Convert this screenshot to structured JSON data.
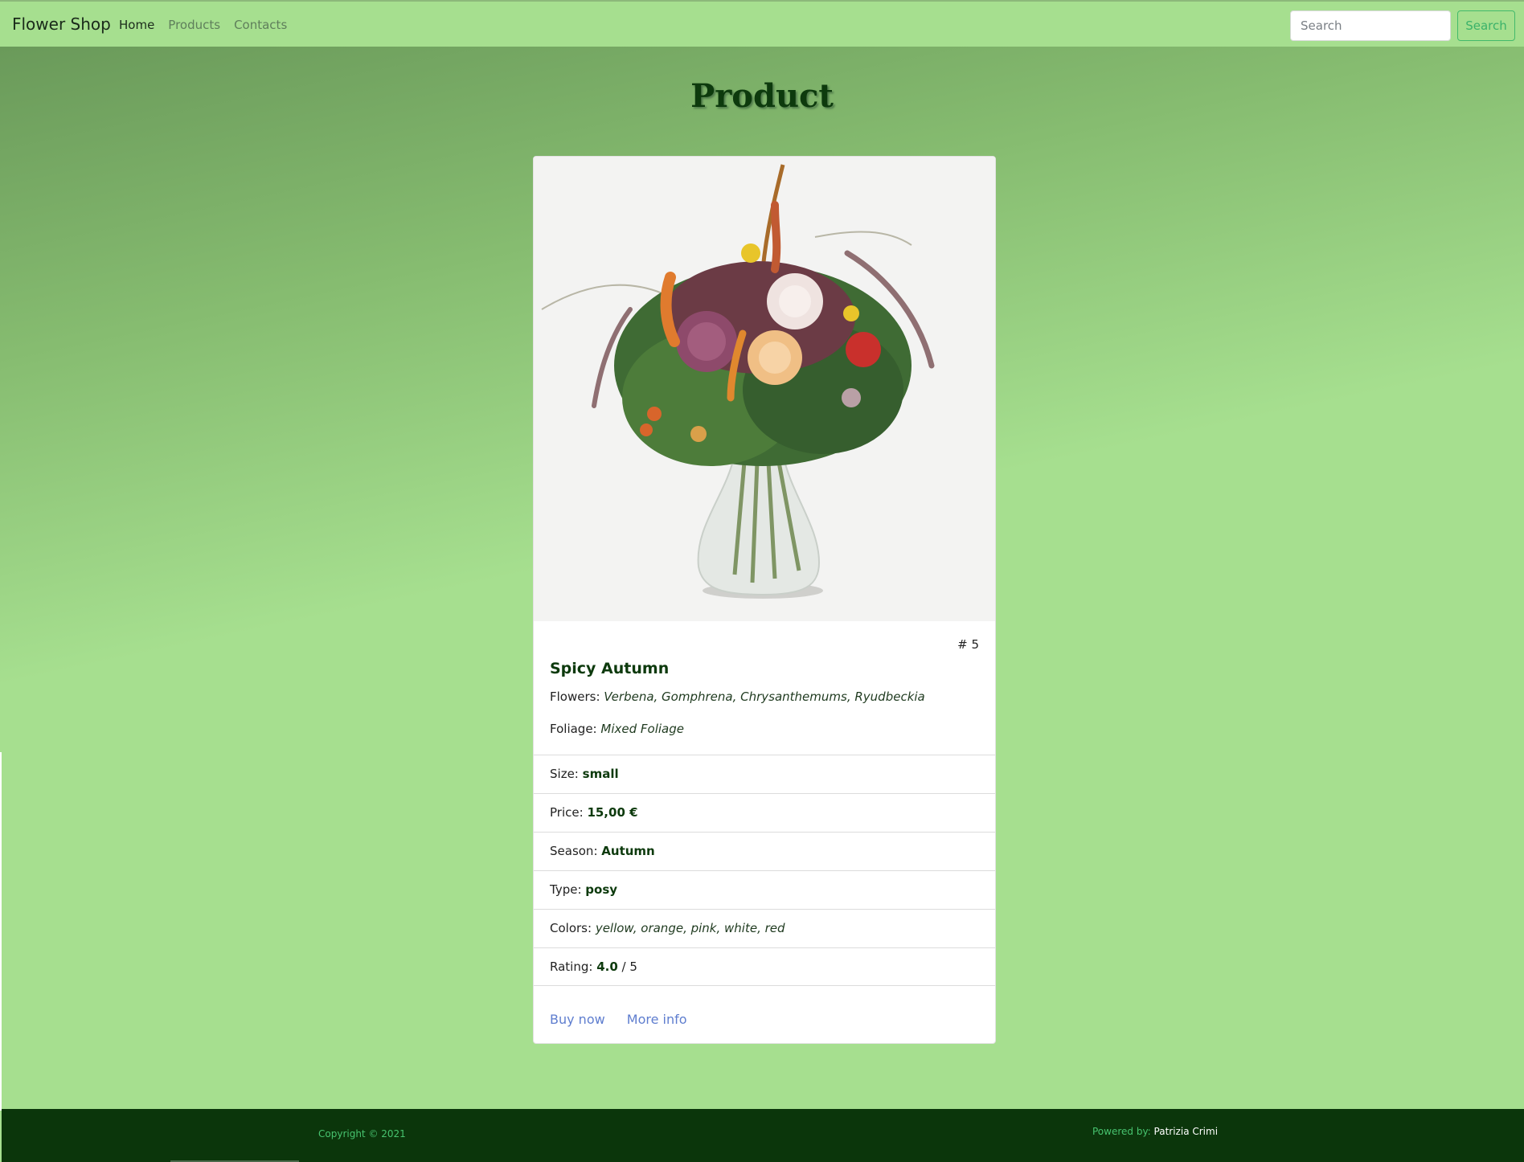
{
  "navbar": {
    "brand": "Flower Shop",
    "links": [
      "Home",
      "Products",
      "Contacts"
    ],
    "search_placeholder": "Search",
    "search_button": "Search"
  },
  "page": {
    "title": "Product"
  },
  "product": {
    "number": "# 5",
    "name": "Spicy Autumn",
    "flowers_label": "Flowers:",
    "flowers": "Verbena, Gomphrena, Chrysanthemums, Ryudbeckia",
    "foliage_label": "Foliage:",
    "foliage": "Mixed Foliage",
    "details": [
      {
        "label": "Size:",
        "value": "small",
        "style": "bold"
      },
      {
        "label": "Price:",
        "value": "15,00 €",
        "style": "bold"
      },
      {
        "label": "Season:",
        "value": "Autumn",
        "style": "bold"
      },
      {
        "label": "Type:",
        "value": "posy",
        "style": "bold"
      },
      {
        "label": "Colors:",
        "value": "yellow, orange, pink, white, red",
        "style": "italic"
      }
    ],
    "rating_label": "Rating:",
    "rating_value": "4.0",
    "rating_max": " / 5",
    "carousel_prev": "‹",
    "actions": [
      "Buy now",
      "More info"
    ]
  },
  "footer": {
    "copyright": "Copyright © 2021",
    "powered_label": "Powered by: ",
    "powered_name": "Patrizia Crimi"
  }
}
